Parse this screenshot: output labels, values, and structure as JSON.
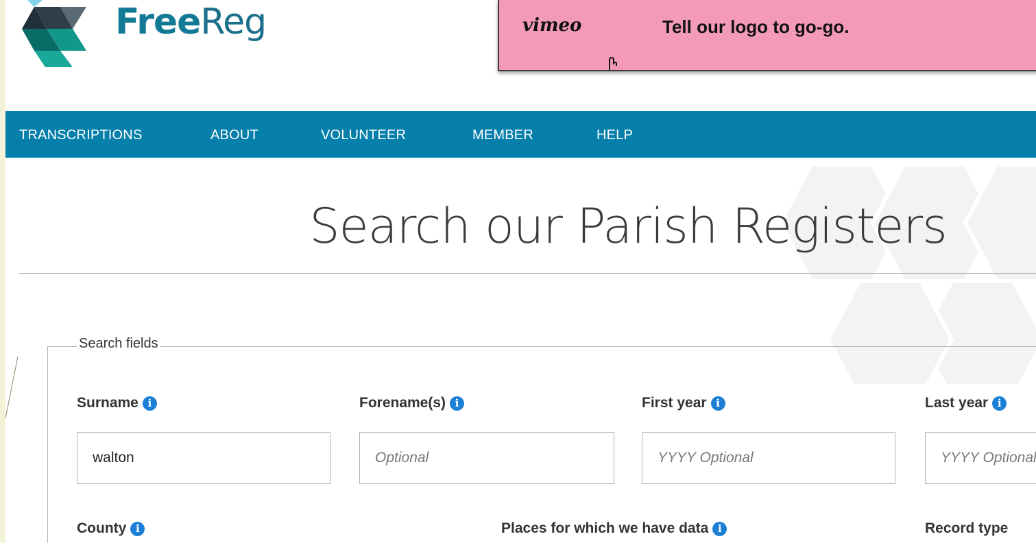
{
  "logo": {
    "text_bold": "Free",
    "text_light": "Reg"
  },
  "ad": {
    "brand": "vimeo",
    "tagline": "Tell our logo to go-go."
  },
  "nav": {
    "items": [
      "TRANSCRIPTIONS",
      "ABOUT",
      "VOLUNTEER",
      "MEMBER",
      "HELP"
    ]
  },
  "page_title": "Search our Parish Registers",
  "search": {
    "legend": "Search fields",
    "surname": {
      "label": "Surname",
      "value": "walton",
      "placeholder": ""
    },
    "forename": {
      "label": "Forename(s)",
      "value": "",
      "placeholder": "Optional"
    },
    "first_year": {
      "label": "First year",
      "value": "",
      "placeholder": "YYYY Optional"
    },
    "last_year": {
      "label": "Last year",
      "value": "",
      "placeholder": "YYYY Optional"
    },
    "county": {
      "label": "County"
    },
    "places": {
      "label": "Places for which we have data"
    },
    "record_type": {
      "label": "Record type"
    }
  },
  "colors": {
    "nav_bg": "#0680ab",
    "logo_blue": "#137a96",
    "ad_bg": "#f39ab6",
    "info_icon": "#1c7fd6"
  },
  "icons": {
    "info": "info-icon",
    "logo": "hexagon-cube-logo-icon",
    "pointer": "hand-pointer-icon"
  }
}
